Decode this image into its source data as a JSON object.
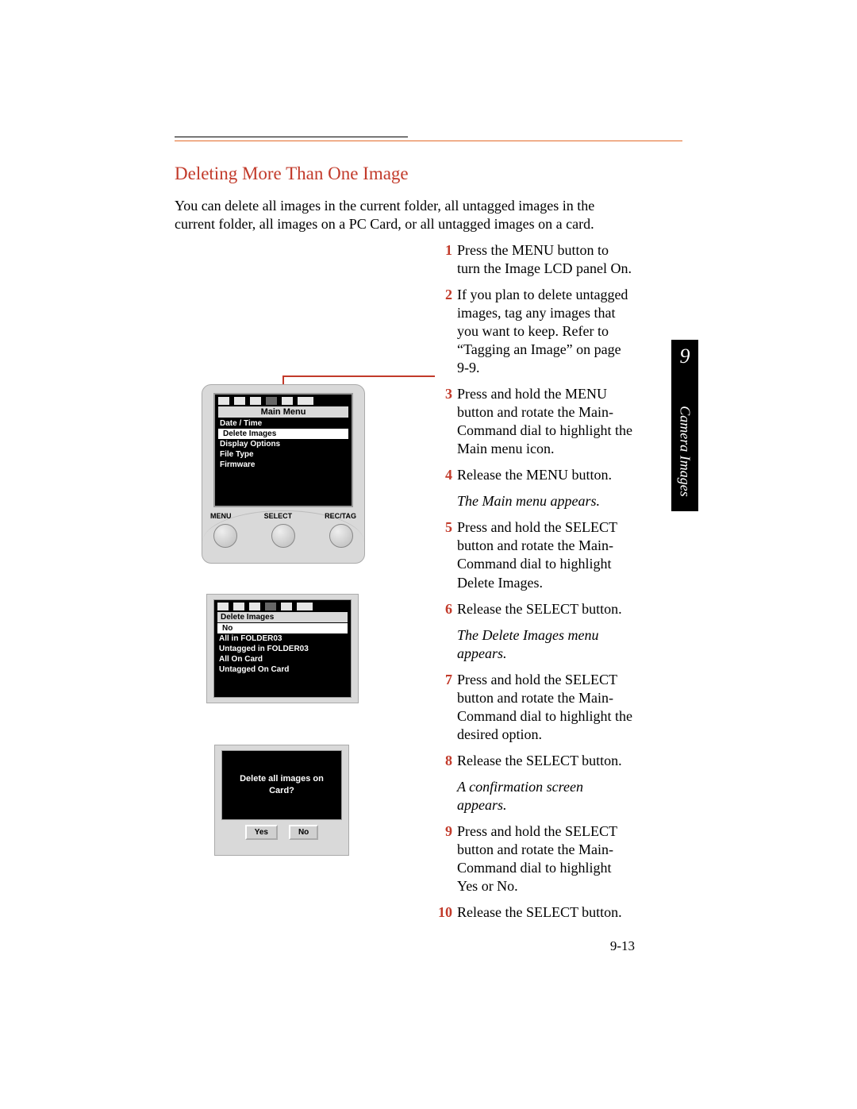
{
  "section_title": "Deleting More Than One Image",
  "intro": "You can delete all images in the current folder, all untagged images in the current folder, all images on a PC Card, or all untagged images on a card.",
  "side_tab": {
    "number": "9",
    "label": "Camera Images"
  },
  "page_number": "9-13",
  "steps": [
    {
      "n": "1",
      "text": "Press the MENU button to turn the Image LCD panel On."
    },
    {
      "n": "2",
      "text": "If you plan to delete untagged images, tag any images that you want to keep. Refer to “Tagging an Image” on page 9-9."
    },
    {
      "n": "3",
      "text": "Press and hold the MENU button and rotate the Main-Command dial to highlight the Main menu icon."
    },
    {
      "n": "4",
      "text": "Release the MENU button."
    }
  ],
  "note_after_4": "The Main menu appears.",
  "steps_b": [
    {
      "n": "5",
      "text": "Press and hold the SELECT button and rotate the Main-Command dial to highlight Delete Images."
    },
    {
      "n": "6",
      "text": "Release the SELECT button."
    }
  ],
  "note_after_6": "The Delete Images menu appears.",
  "steps_c": [
    {
      "n": "7",
      "text": "Press and hold the SELECT button and rotate the Main-Command dial to highlight the desired option."
    },
    {
      "n": "8",
      "text": "Release the SELECT button."
    }
  ],
  "note_after_8": "A confirmation screen appears.",
  "steps_d": [
    {
      "n": "9",
      "text": "Press and hold the SELECT button and rotate the Main-Command dial to highlight Yes or No."
    },
    {
      "n": "10",
      "text": "Release the SELECT button."
    }
  ],
  "fig1": {
    "title": "Main Menu",
    "items": [
      "Date / Time",
      "Delete Images",
      "Display Options",
      "File Type",
      "Firmware"
    ],
    "selected_index": 1,
    "btn_labels": [
      "MENU",
      "SELECT",
      "REC/TAG"
    ]
  },
  "fig2": {
    "title": "Delete Images",
    "items": [
      "No",
      "All in FOLDER03",
      "Untagged in FOLDER03",
      "All On Card",
      "Untagged On Card"
    ],
    "selected_index": 0
  },
  "fig3": {
    "message": "Delete all images on Card?",
    "yes": "Yes",
    "no": "No"
  }
}
